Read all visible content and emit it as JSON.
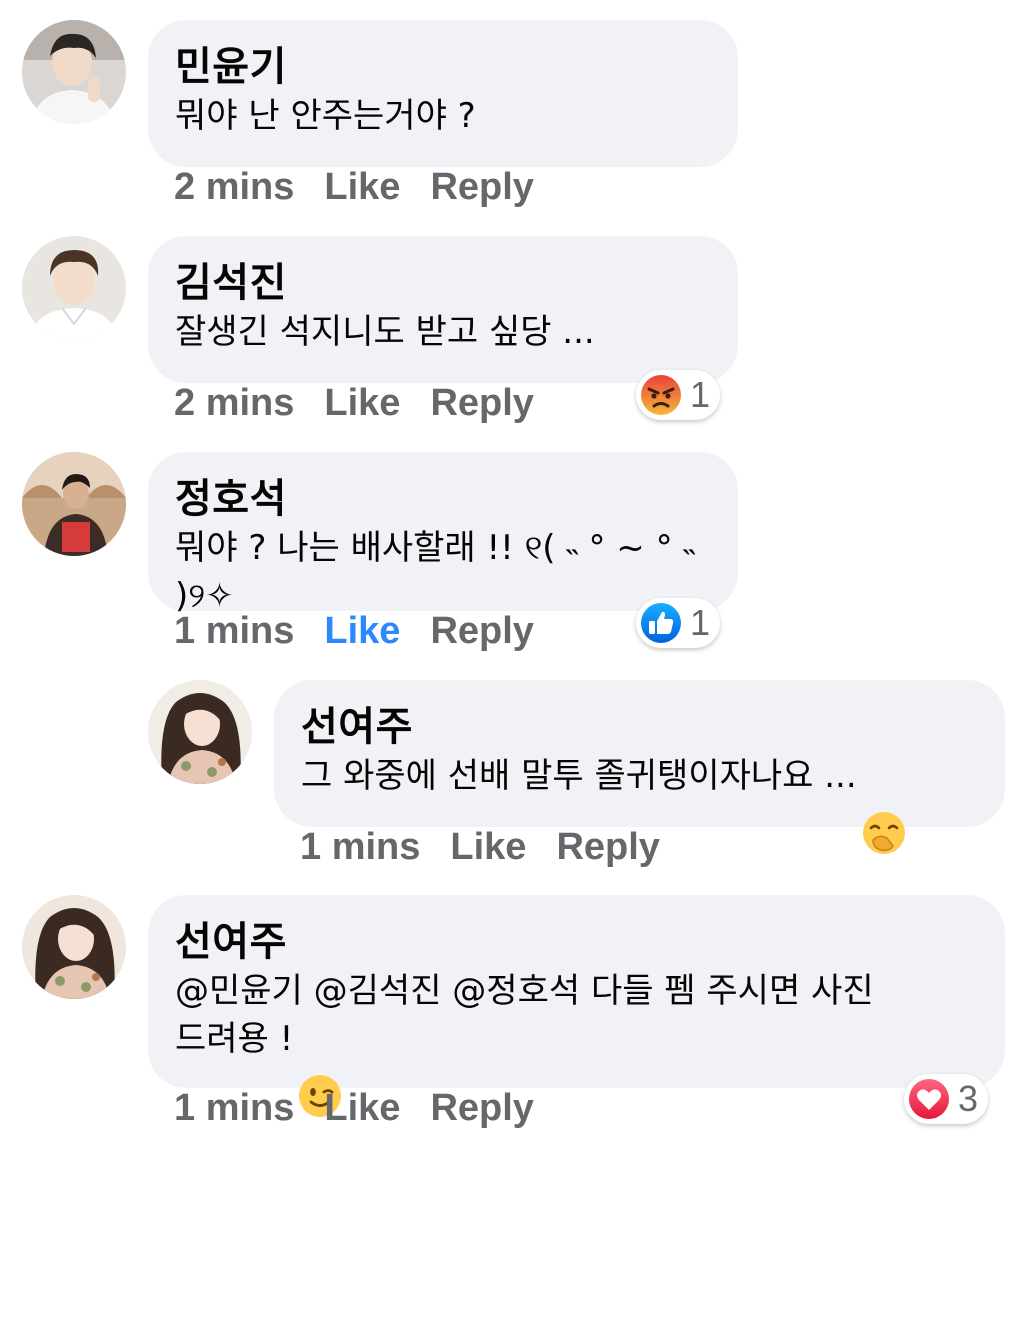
{
  "comments": [
    {
      "name": "민윤기",
      "text": "뭐야 난 안주는거야 ?",
      "time": "2 mins",
      "like": "Like",
      "reply": "Reply"
    },
    {
      "name": "김석진",
      "text": "잘생긴 석지니도 받고 싶당 ...",
      "time": "2 mins",
      "like": "Like",
      "reply": "Reply",
      "reaction": {
        "icon": "angry-emoji-icon",
        "count": "1"
      }
    },
    {
      "name": "정호석",
      "text": "뭐야 ? 나는 배사할래 !! ୧( ˵ ° ~ ° ˵ )୨✧",
      "time": "1 mins",
      "like": "Like",
      "reply": "Reply",
      "like_active": true,
      "reaction": {
        "icon": "thumbs-up-icon",
        "count": "1"
      }
    },
    {
      "name": "선여주",
      "text": "그 와중에 선배 말투 졸귀탱이자나요 ...",
      "emoji": "hand-over-mouth-emoji-icon",
      "time": "1 mins",
      "like": "Like",
      "reply": "Reply",
      "is_reply": true
    },
    {
      "name": "선여주",
      "text": "@민윤기 @김석진 @정호석 다들 펨 주시면 사진\n드려용 !",
      "emoji": "winking-face-emoji-icon",
      "time": "1 mins",
      "like": "Like",
      "reply": "Reply",
      "reaction": {
        "icon": "heart-icon",
        "count": "3"
      }
    }
  ],
  "colors": {
    "bubble": "#f0f2f5",
    "meta_text": "#65676b",
    "like_active": "#2d88ff",
    "angry": "#f0782f",
    "like_blue": "#1877f2",
    "love_red": "#f33e58"
  }
}
